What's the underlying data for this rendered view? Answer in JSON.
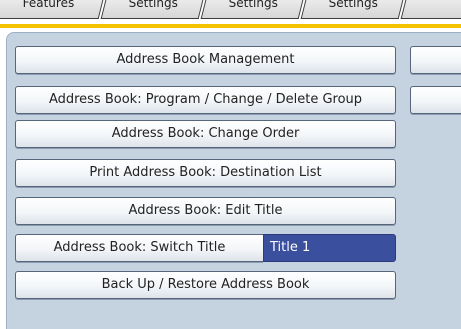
{
  "tabs": [
    {
      "label": "Features"
    },
    {
      "label": "Settings"
    },
    {
      "label": "Settings"
    },
    {
      "label": "Settings"
    },
    {
      "label": ""
    }
  ],
  "buttons": [
    {
      "label": "Address Book Management"
    },
    {
      "label": "Address Book: Program / Change / Delete Group"
    },
    {
      "label": "Address Book: Change Order"
    },
    {
      "label": "Print Address Book: Destination List"
    },
    {
      "label": "Address Book: Edit Title"
    },
    {
      "label": "Address Book: Switch Title",
      "value": "Title 1"
    },
    {
      "label": "Back Up / Restore Address Book"
    }
  ],
  "colors": {
    "accent": "#f3c300",
    "panel": "#c5d2e0",
    "selected_value": "#3a4f9e"
  }
}
